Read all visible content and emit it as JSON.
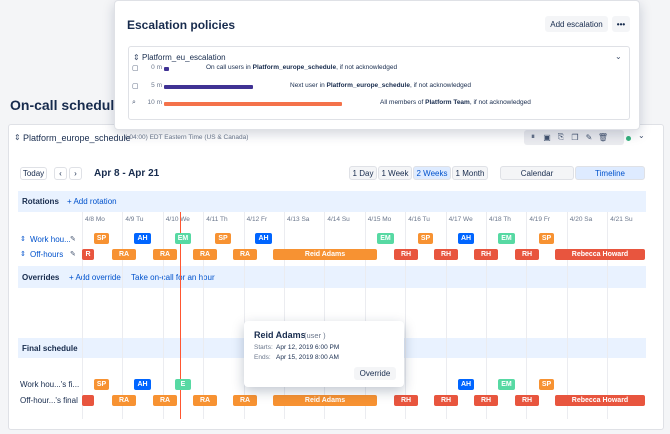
{
  "oncall": {
    "title": "On-call schedules"
  },
  "schedule": {
    "name": "Platform_europe_schedule",
    "timezone": "(-04:00) EDT Eastern Time (US & Canada)",
    "status_color": "#36b37e"
  },
  "toolbar": {
    "today": "Today",
    "prev": "‹",
    "next": "›",
    "range": "Apr 8 - Apr 21",
    "views": [
      "1 Day",
      "1 Week",
      "2 Weeks",
      "1 Month"
    ],
    "active_view": "2 Weeks",
    "modes": [
      "Calendar",
      "Timeline"
    ],
    "active_mode": "Timeline"
  },
  "rotations": {
    "title": "Rotations",
    "add": "+ Add rotation"
  },
  "overrides": {
    "title": "Overrides",
    "add": "+ Add override",
    "take": "Take on-call for an hour"
  },
  "final": {
    "title": "Final schedule"
  },
  "days": [
    "4/8 Mo",
    "4/9 Tu",
    "4/10 We",
    "4/11 Th",
    "4/12 Fr",
    "4/13 Sa",
    "4/14 Su",
    "4/15 Mo",
    "4/16 Tu",
    "4/17 We",
    "4/18 Th",
    "4/19 Fr",
    "4/20 Sa",
    "4/21 Su"
  ],
  "rows": {
    "work_hours": "Work hou...",
    "off_hours": "Off-hours",
    "final_work": "Work hou...'s fi...",
    "final_off": "Off-hour...'s final"
  },
  "chips": {
    "sp": "SP",
    "ah": "AH",
    "em": "EM",
    "e": "E",
    "r": "R",
    "ra": "RA",
    "rh": "RH",
    "reid": "Reid Adams",
    "rebecca": "Rebecca Howard"
  },
  "tooltip": {
    "name": "Reid Adams",
    "role": "(user )",
    "starts_label": "Starts:",
    "starts": "Apr 12, 2019 6:00 PM",
    "ends_label": "Ends:",
    "ends": "Apr 15, 2019 8:00 AM",
    "override": "Override"
  },
  "escalation": {
    "title": "Escalation policies",
    "add": "Add escalation",
    "policy": "Platform_eu_escalation",
    "steps": [
      {
        "time": "0 m",
        "pre": "On call users in ",
        "bold": "Platform_europe_schedule",
        "post": ", if not acknowledged",
        "color": "#403294",
        "fraction": 0.03
      },
      {
        "time": "5 m",
        "pre": "Next user in ",
        "bold": "Platform_europe_schedule",
        "post": ", if not acknowledged",
        "color": "#403294",
        "fraction": 0.5
      },
      {
        "time": "10 m",
        "pre": "All members of ",
        "bold": "Platform Team",
        "post": ", if not acknowledged",
        "color": "#f4724a",
        "fraction": 1.0
      }
    ]
  }
}
